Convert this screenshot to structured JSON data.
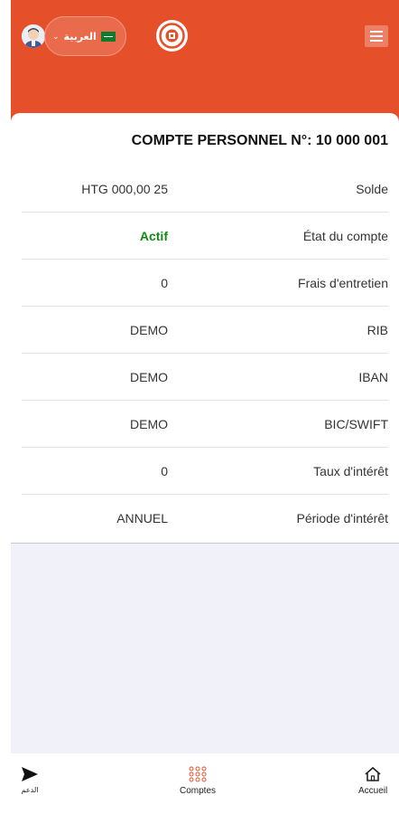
{
  "header": {
    "language_label": "العربية",
    "language_flag": "saudi-arabia-flag",
    "brand_color": "#e5502a"
  },
  "account": {
    "title": "COMPTE PERSONNEL N°: 10 000 001",
    "rows": [
      {
        "label": "Solde",
        "value": "HTG 000,00 25"
      },
      {
        "label": "État du compte",
        "value": "Actif",
        "status_color": "#138a13"
      },
      {
        "label": "Frais d'entretien",
        "value": "0"
      },
      {
        "label": "RIB",
        "value": "DEMO"
      },
      {
        "label": "IBAN",
        "value": "DEMO"
      },
      {
        "label": "BIC/SWIFT",
        "value": "DEMO"
      },
      {
        "label": "Taux d'intérêt",
        "value": "0"
      },
      {
        "label": "Période d'intérêt",
        "value": "ANNUEL"
      }
    ]
  },
  "bottom_nav": {
    "support_label": "الدعم",
    "accounts_label": "Comptes",
    "home_label": "Accueil"
  }
}
